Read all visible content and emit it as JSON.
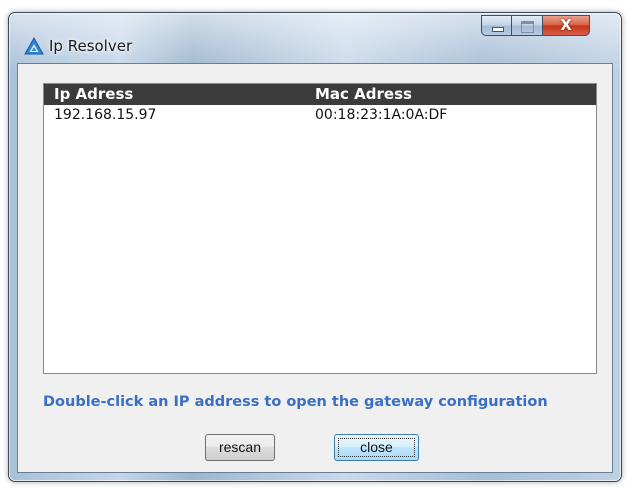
{
  "window": {
    "title": "Ip Resolver",
    "close_glyph": "X"
  },
  "table": {
    "columns": [
      "Ip Adress",
      "Mac Adress"
    ],
    "rows": [
      {
        "ip": "192.168.15.97",
        "mac": "00:18:23:1A:0A:DF"
      }
    ]
  },
  "hint": {
    "text": "Double-click an IP address to open the gateway configuration",
    "color": "#3a6fc4"
  },
  "buttons": {
    "rescan_label": "rescan",
    "close_label": "close"
  },
  "icons": {
    "app": "triangle-logo-icon",
    "minimize": "minimize-icon",
    "maximize": "maximize-icon",
    "close": "close-icon"
  }
}
